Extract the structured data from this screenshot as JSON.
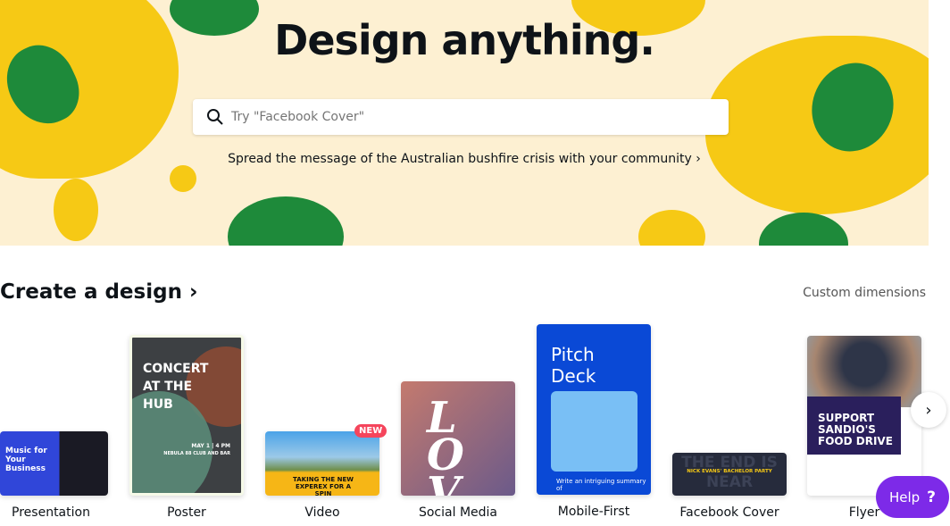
{
  "hero": {
    "title": "Design anything.",
    "search_placeholder": "Try \"Facebook Cover\"",
    "subtitle": "Spread the message of the Australian bushfire crisis with your community",
    "subtitle_arrow": "›"
  },
  "section": {
    "title": "Create a design",
    "title_arrow": "›",
    "custom_dimensions": "Custom dimensions"
  },
  "cards": [
    {
      "label": "Presentation",
      "thumb_text": "Music for Your Business"
    },
    {
      "label": "Poster",
      "thumb_text": "CONCERT AT THE HUB",
      "thumb_sub": "MAY 1 | 4 PM",
      "thumb_sub2": "NEBULA 88 CLUB AND BAR"
    },
    {
      "label": "Video",
      "thumb_text": "TAKING THE NEW EXPEREX FOR A SPIN",
      "badge": "NEW"
    },
    {
      "label": "Social Media",
      "thumb_text": "LOVE"
    },
    {
      "label": "Mobile-First",
      "thumb_text": "Pitch Deck",
      "thumb_sub": "Write an intriguing summary of"
    },
    {
      "label": "Facebook Cover",
      "thumb_text": "NICK EVANS' BACHELOR PARTY",
      "thumb_bg_text": "THE END IS NEAR"
    },
    {
      "label": "Flyer",
      "thumb_text": "SUPPORT SANDIO'S FOOD DRIVE"
    }
  ],
  "help": {
    "label": "Help",
    "icon": "?"
  },
  "next_icon": "›",
  "colors": {
    "accent": "#7d2ae8",
    "banner_bg": "#fdf0d2",
    "yellow": "#f6c915",
    "green": "#1e8a3a",
    "badge": "#f5455c"
  }
}
